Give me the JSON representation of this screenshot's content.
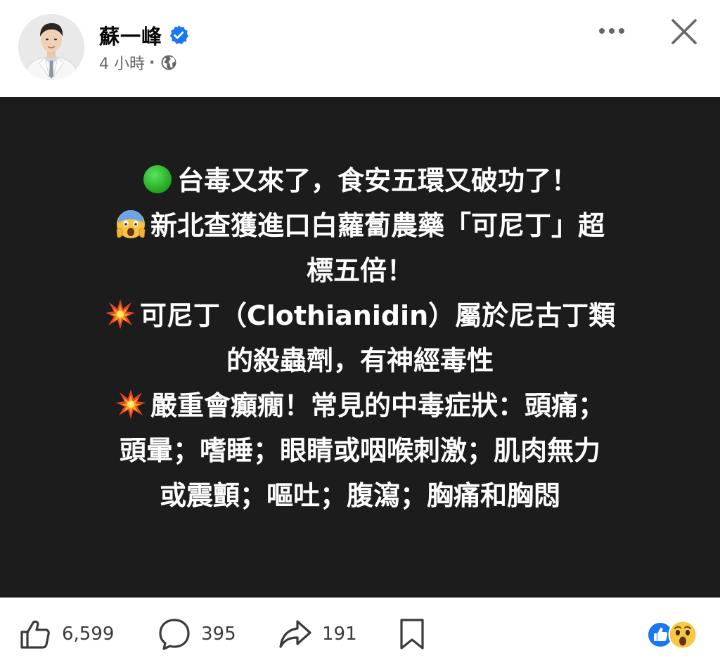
{
  "post": {
    "author": "蘇一峰",
    "time": "4 小時",
    "dot": "·",
    "lines": [
      {
        "emoji": "green-circle",
        "text": "台毒又來了，食安五環又破功了！"
      },
      {
        "emoji": "scream-face",
        "text": "新北查獲進口白蘿蔔農藥「可尼丁」超"
      },
      {
        "emoji": "",
        "text": "標五倍！"
      },
      {
        "emoji": "collision",
        "text": "可尼丁（Clothianidin）屬於尼古丁類"
      },
      {
        "emoji": "",
        "text": "的殺蟲劑，有神經毒性"
      },
      {
        "emoji": "collision",
        "text": "嚴重會癲癇！常見的中毒症狀：頭痛；"
      },
      {
        "emoji": "",
        "text": "頭暈；嗜睡；眼睛或咽喉刺激；肌肉無力"
      },
      {
        "emoji": "",
        "text": "或震顫；嘔吐；腹瀉；胸痛和胸悶"
      }
    ]
  },
  "actions": {
    "like_count": "6,599",
    "comment_count": "395",
    "share_count": "191"
  },
  "icons": {
    "verified": "verified-badge-icon",
    "globe": "globe-icon",
    "more": "more-icon",
    "close": "close-icon",
    "like": "thumbs-up-icon",
    "comment": "comment-bubble-icon",
    "share": "share-arrow-icon",
    "save": "bookmark-icon",
    "reactions": [
      "like-reaction-icon",
      "wow-reaction-icon"
    ]
  },
  "colors": {
    "card_background": "#1c1c1c",
    "verified_blue": "#1877f2",
    "text_secondary": "#65676b"
  }
}
